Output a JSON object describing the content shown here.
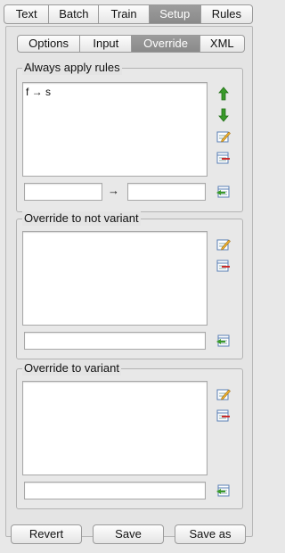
{
  "top_tabs": [
    "Text",
    "Batch",
    "Train",
    "Setup",
    "Rules"
  ],
  "active_top_tab": "Setup",
  "sub_tabs": [
    "Options",
    "Input",
    "Override",
    "XML"
  ],
  "active_sub_tab": "Override",
  "always_apply": {
    "title": "Always apply rules",
    "rules": [
      "f → s"
    ],
    "from_value": "",
    "to_value": "",
    "separator": "→"
  },
  "override_not_variant": {
    "title": "Override to not variant",
    "input_value": ""
  },
  "override_variant": {
    "title": "Override to variant",
    "input_value": ""
  },
  "buttons": {
    "revert": "Revert",
    "save": "Save",
    "save_as": "Save as"
  },
  "icons": {
    "move_up": "arrow-up-icon",
    "move_down": "arrow-down-icon",
    "edit": "edit-icon",
    "delete": "delete-icon",
    "add": "add-icon"
  },
  "colors": {
    "active_tab": "#8e8e8e",
    "arrow_green": "#3a9a2a",
    "delete_red": "#cc2a2a"
  }
}
